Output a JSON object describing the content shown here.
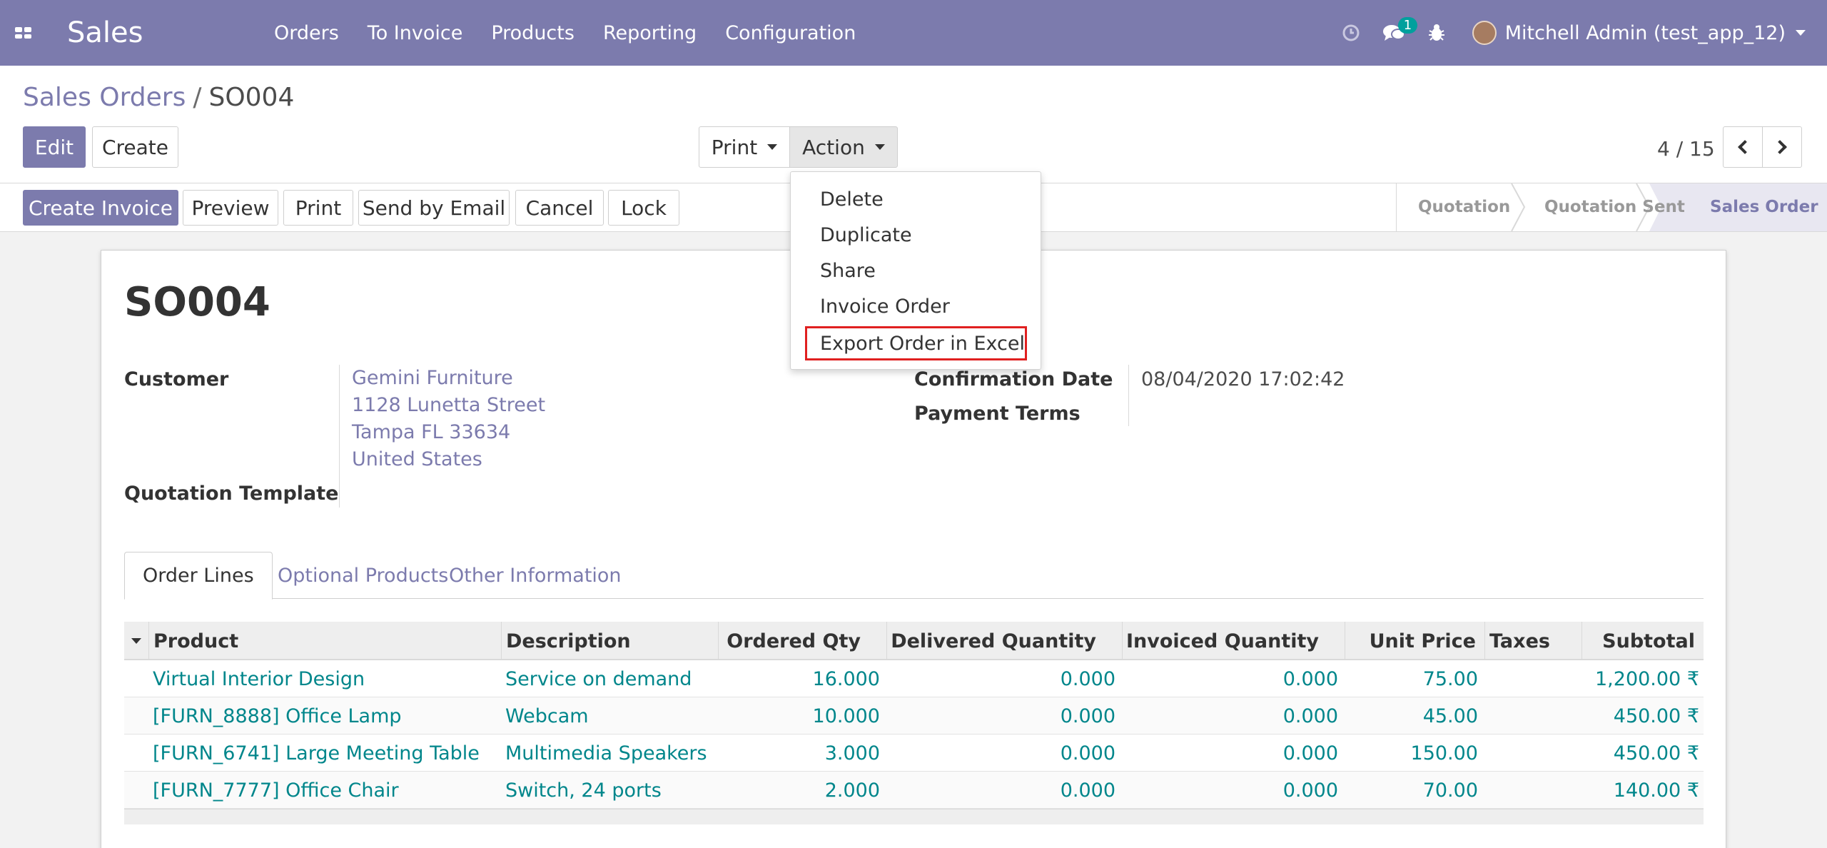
{
  "navbar": {
    "brand": "Sales",
    "menu": [
      "Orders",
      "To Invoice",
      "Products",
      "Reporting",
      "Configuration"
    ],
    "messages_count": "1",
    "user": "Mitchell Admin (test_app_12)"
  },
  "breadcrumb": {
    "parent": "Sales Orders",
    "separator": "/",
    "current": "SO004"
  },
  "buttons": {
    "edit": "Edit",
    "create": "Create",
    "print": "Print",
    "action": "Action"
  },
  "pager": {
    "value": "4 / 15"
  },
  "statusbar": {
    "actions": [
      "Create Invoice",
      "Preview",
      "Print",
      "Send by Email",
      "Cancel",
      "Lock"
    ],
    "stages": [
      "Quotation",
      "Quotation Sent",
      "Sales Order"
    ],
    "active_stage": "Sales Order"
  },
  "action_menu": {
    "items": [
      "Delete",
      "Duplicate",
      "Share",
      "Invoice Order",
      "Export Order in Excel"
    ],
    "highlighted": "Export Order in Excel"
  },
  "form": {
    "title": "SO004",
    "customer_label": "Customer",
    "customer": [
      "Gemini Furniture",
      "1128 Lunetta Street",
      "Tampa FL 33634",
      "United States"
    ],
    "template_label": "Quotation Template",
    "confirmation_label": "Confirmation Date",
    "confirmation_date": "08/04/2020 17:02:42",
    "payment_terms_label": "Payment Terms"
  },
  "tabs": [
    "Order Lines",
    "Optional Products",
    "Other Information"
  ],
  "table": {
    "headers": [
      "Product",
      "Description",
      "Ordered Qty",
      "Delivered Quantity",
      "Invoiced Quantity",
      "Unit Price",
      "Taxes",
      "Subtotal"
    ],
    "rows": [
      [
        "Virtual Interior Design",
        "Service on demand",
        "16.000",
        "0.000",
        "0.000",
        "75.00",
        "",
        "1,200.00 ₹"
      ],
      [
        "[FURN_8888] Office Lamp",
        "Webcam",
        "10.000",
        "0.000",
        "0.000",
        "45.00",
        "",
        "450.00 ₹"
      ],
      [
        "[FURN_6741] Large Meeting Table",
        "Multimedia Speakers",
        "3.000",
        "0.000",
        "0.000",
        "150.00",
        "",
        "450.00 ₹"
      ],
      [
        "[FURN_7777] Office Chair",
        "Switch, 24 ports",
        "2.000",
        "0.000",
        "0.000",
        "70.00",
        "",
        "140.00 ₹"
      ]
    ]
  },
  "colors": {
    "brand": "#7c7bad",
    "link": "#00868b",
    "highlight_border": "#e02020"
  }
}
